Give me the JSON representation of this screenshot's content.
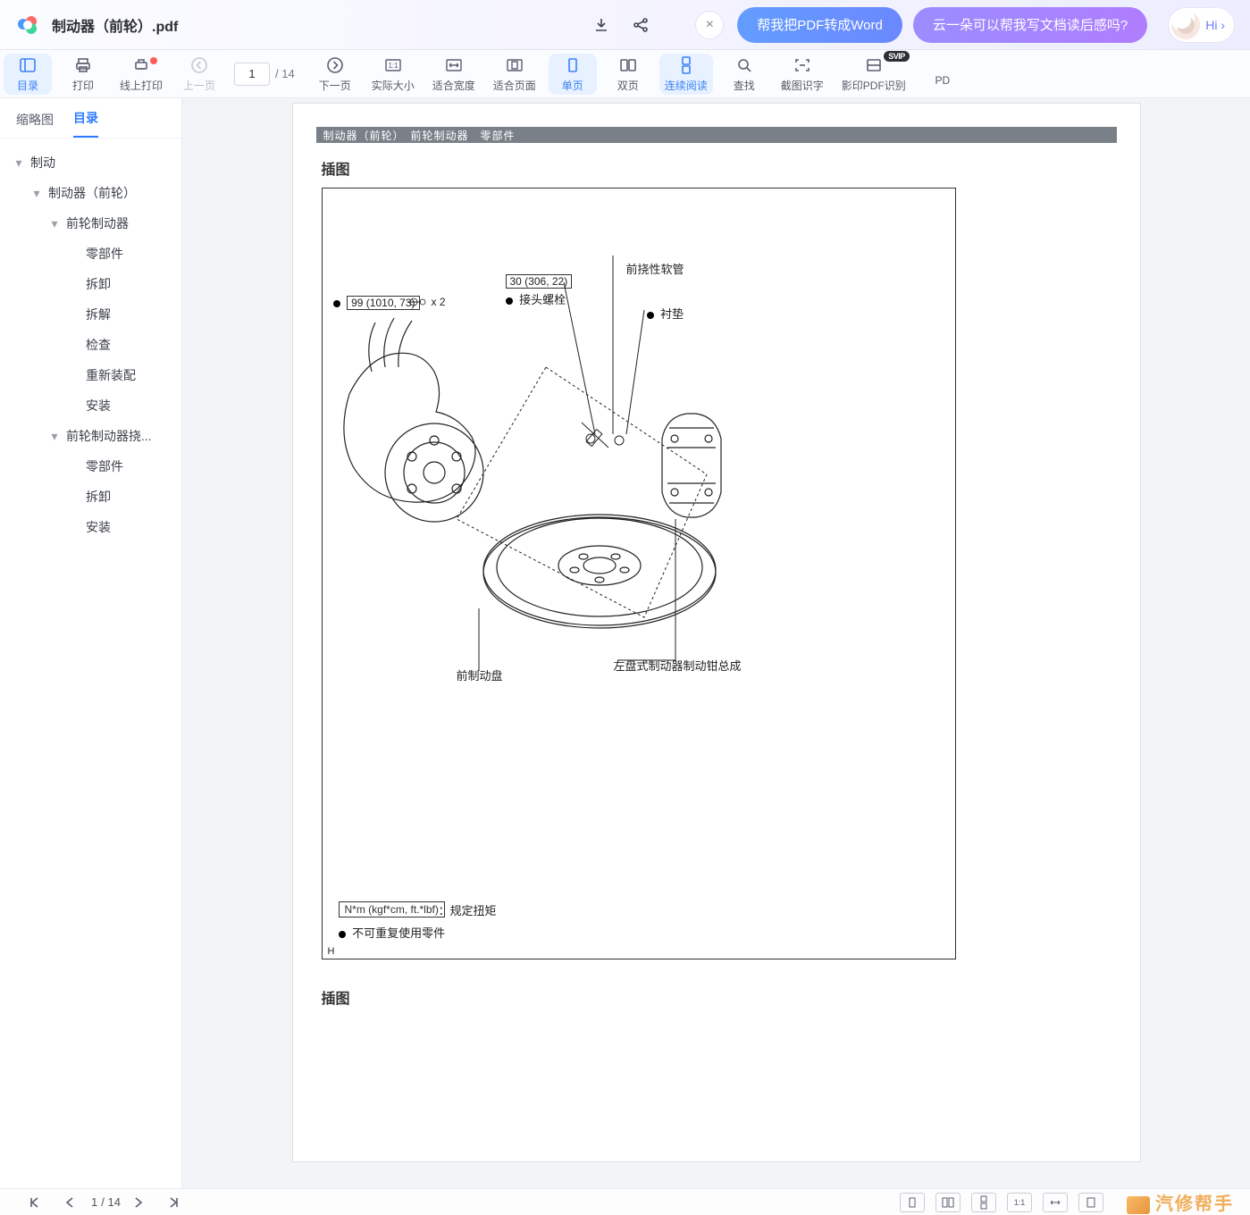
{
  "title": "制动器（前轮）.pdf",
  "prompts": {
    "close_icon": "×",
    "pill1": "帮我把PDF转成Word",
    "pill2": "云一朵可以帮我写文档读后感吗?",
    "hi": "Hi ›"
  },
  "toolbar": {
    "page_current": "1",
    "page_sep": "/ 14",
    "items": [
      {
        "id": "outline",
        "label": "目录",
        "active": true
      },
      {
        "id": "print",
        "label": "打印"
      },
      {
        "id": "online_print",
        "label": "线上打印",
        "dot": true
      },
      {
        "id": "prev",
        "label": "上一页",
        "disabled": true
      },
      {
        "id": "pagebox"
      },
      {
        "id": "next",
        "label": "下一页"
      },
      {
        "id": "actual",
        "label": "实际大小"
      },
      {
        "id": "fitw",
        "label": "适合宽度"
      },
      {
        "id": "fitp",
        "label": "适合页面"
      },
      {
        "id": "single",
        "label": "单页",
        "active": true
      },
      {
        "id": "double",
        "label": "双页"
      },
      {
        "id": "continuous",
        "label": "连续阅读",
        "active": true
      },
      {
        "id": "find",
        "label": "查找"
      },
      {
        "id": "ocr",
        "label": "截图识字"
      },
      {
        "id": "scanpdf",
        "label": "影印PDF识别",
        "badge": "SVIP"
      },
      {
        "id": "pd",
        "label": "PD"
      }
    ]
  },
  "side_tabs": {
    "thumb": "缩略图",
    "toc": "目录"
  },
  "tree": [
    {
      "l": 0,
      "tw": true,
      "label": "制动"
    },
    {
      "l": 1,
      "tw": true,
      "label": "制动器（前轮）"
    },
    {
      "l": 2,
      "tw": true,
      "label": "前轮制动器"
    },
    {
      "l": 3,
      "label": "零部件"
    },
    {
      "l": 3,
      "label": "拆卸"
    },
    {
      "l": 3,
      "label": "拆解"
    },
    {
      "l": 3,
      "label": "检查"
    },
    {
      "l": 3,
      "label": "重新装配"
    },
    {
      "l": 3,
      "label": "安装"
    },
    {
      "l": 2,
      "tw": true,
      "label": "前轮制动器挠..."
    },
    {
      "l": 3,
      "label": "零部件"
    },
    {
      "l": 3,
      "label": "拆卸"
    },
    {
      "l": 3,
      "label": "安装"
    }
  ],
  "doc": {
    "band": "制动器（前轮）　前轮制动器　零部件",
    "sec1": "插图",
    "sec2": "插图",
    "fig": {
      "hose": "前挠性软管",
      "bolt_val": "30 (306, 22)",
      "bolt_lbl": "接头螺栓",
      "gasket": "衬垫",
      "torque_val": "99 (1010, 73)",
      "x2": "x 2",
      "caliper": "左盘式制动器制动钳总成",
      "disc": "前制动盘",
      "legend_box": "N*m (kgf*cm, ft.*lbf)",
      "legend_txt": "：规定扭矩",
      "noreuse": "不可重复使用零件",
      "h": "H"
    }
  },
  "bottom": {
    "page_current": "1",
    "page_sep": "/ 14",
    "watermark": "汽修帮手"
  }
}
